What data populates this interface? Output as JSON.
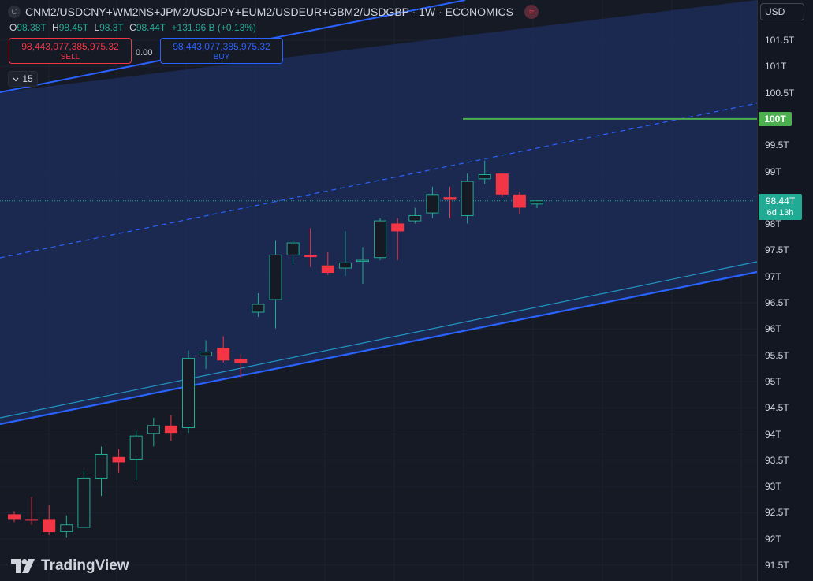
{
  "header": {
    "title": "CNM2/USDCNY+WM2NS+JPM2/USDJPY+EUM2/USDEUR+GBM2/USDGBP · 1W · ECONOMICS",
    "logo_glyph": "C",
    "badge_glyph": "≈"
  },
  "ohlc": {
    "o_label": "O",
    "o": "98.38T",
    "h_label": "H",
    "h": "98.45T",
    "l_label": "L",
    "l": "98.3T",
    "c_label": "C",
    "c": "98.44T",
    "change": "+131.96 B (+0.13%)"
  },
  "trade": {
    "sell_price": "98,443,077,385,975.32",
    "sell_label": "SELL",
    "spread": "0.00",
    "buy_price": "98,443,077,385,975.32",
    "buy_label": "BUY"
  },
  "interval": {
    "label": "15",
    "icon": "chevron-down-icon"
  },
  "axis": {
    "currency": "USD",
    "ticks": [
      "101.5T",
      "101T",
      "100.5T",
      "100T",
      "99.5T",
      "99T",
      "98.5T",
      "98T",
      "97.5T",
      "97T",
      "96.5T",
      "96T",
      "95.5T",
      "95T",
      "94.5T",
      "94T",
      "93.5T",
      "93T",
      "92.5T",
      "92T",
      "91.5T"
    ],
    "horizontal_level_label": "100T",
    "current_price_label": "98.44T",
    "countdown": "6d 13h"
  },
  "branding": {
    "name": "TradingView"
  },
  "colors": {
    "background": "#161a25",
    "up": "#22ab94",
    "down": "#f23645",
    "channel_line": "#2962ff",
    "channel_fill": "#1e2d5e",
    "level_line": "#4caf50",
    "axis_bg": "#131722"
  },
  "chart_data": {
    "type": "candlestick",
    "timeframe": "1W",
    "ylim": [
      91.4,
      101.8
    ],
    "y_unit": "T",
    "candles": [
      {
        "o": 92.47,
        "h": 92.53,
        "l": 92.32,
        "c": 92.38
      },
      {
        "o": 92.38,
        "h": 92.8,
        "l": 92.27,
        "c": 92.35
      },
      {
        "o": 92.38,
        "h": 92.65,
        "l": 92.07,
        "c": 92.13
      },
      {
        "o": 92.14,
        "h": 92.45,
        "l": 92.03,
        "c": 92.27
      },
      {
        "o": 92.22,
        "h": 93.29,
        "l": 92.22,
        "c": 93.16
      },
      {
        "o": 93.16,
        "h": 93.76,
        "l": 92.82,
        "c": 93.61
      },
      {
        "o": 93.56,
        "h": 93.71,
        "l": 93.26,
        "c": 93.46
      },
      {
        "o": 93.52,
        "h": 94.06,
        "l": 93.12,
        "c": 93.96
      },
      {
        "o": 94.01,
        "h": 94.31,
        "l": 93.76,
        "c": 94.16
      },
      {
        "o": 94.16,
        "h": 94.36,
        "l": 93.87,
        "c": 94.02
      },
      {
        "o": 94.12,
        "h": 95.59,
        "l": 94.02,
        "c": 95.44
      },
      {
        "o": 95.49,
        "h": 95.79,
        "l": 95.24,
        "c": 95.56
      },
      {
        "o": 95.64,
        "h": 95.86,
        "l": 95.36,
        "c": 95.4
      },
      {
        "o": 95.42,
        "h": 95.51,
        "l": 95.07,
        "c": 95.35
      },
      {
        "o": 96.32,
        "h": 96.68,
        "l": 96.23,
        "c": 96.47
      },
      {
        "o": 96.56,
        "h": 97.68,
        "l": 96.01,
        "c": 97.41
      },
      {
        "o": 97.41,
        "h": 97.68,
        "l": 97.23,
        "c": 97.64
      },
      {
        "o": 97.41,
        "h": 97.92,
        "l": 97.18,
        "c": 97.37
      },
      {
        "o": 97.21,
        "h": 97.46,
        "l": 97.03,
        "c": 97.07
      },
      {
        "o": 97.16,
        "h": 97.86,
        "l": 97.01,
        "c": 97.26
      },
      {
        "o": 97.29,
        "h": 97.56,
        "l": 96.86,
        "c": 97.31
      },
      {
        "o": 97.36,
        "h": 98.11,
        "l": 97.31,
        "c": 98.06
      },
      {
        "o": 98.01,
        "h": 98.11,
        "l": 97.31,
        "c": 97.86
      },
      {
        "o": 98.06,
        "h": 98.31,
        "l": 98.01,
        "c": 98.16
      },
      {
        "o": 98.21,
        "h": 98.71,
        "l": 98.11,
        "c": 98.56
      },
      {
        "o": 98.51,
        "h": 98.71,
        "l": 98.11,
        "c": 98.46
      },
      {
        "o": 98.16,
        "h": 98.96,
        "l": 98.01,
        "c": 98.81
      },
      {
        "o": 98.86,
        "h": 99.21,
        "l": 98.76,
        "c": 98.94
      },
      {
        "o": 98.96,
        "h": 98.96,
        "l": 98.51,
        "c": 98.56
      },
      {
        "o": 98.56,
        "h": 98.61,
        "l": 98.18,
        "c": 98.31
      },
      {
        "o": 98.38,
        "h": 98.45,
        "l": 98.3,
        "c": 98.44
      }
    ],
    "horizontal_level": 100.0,
    "current_price": 98.44,
    "annotations": [
      "ascending parallel channel",
      "dashed channel midline",
      "horizontal level at 100T"
    ]
  }
}
